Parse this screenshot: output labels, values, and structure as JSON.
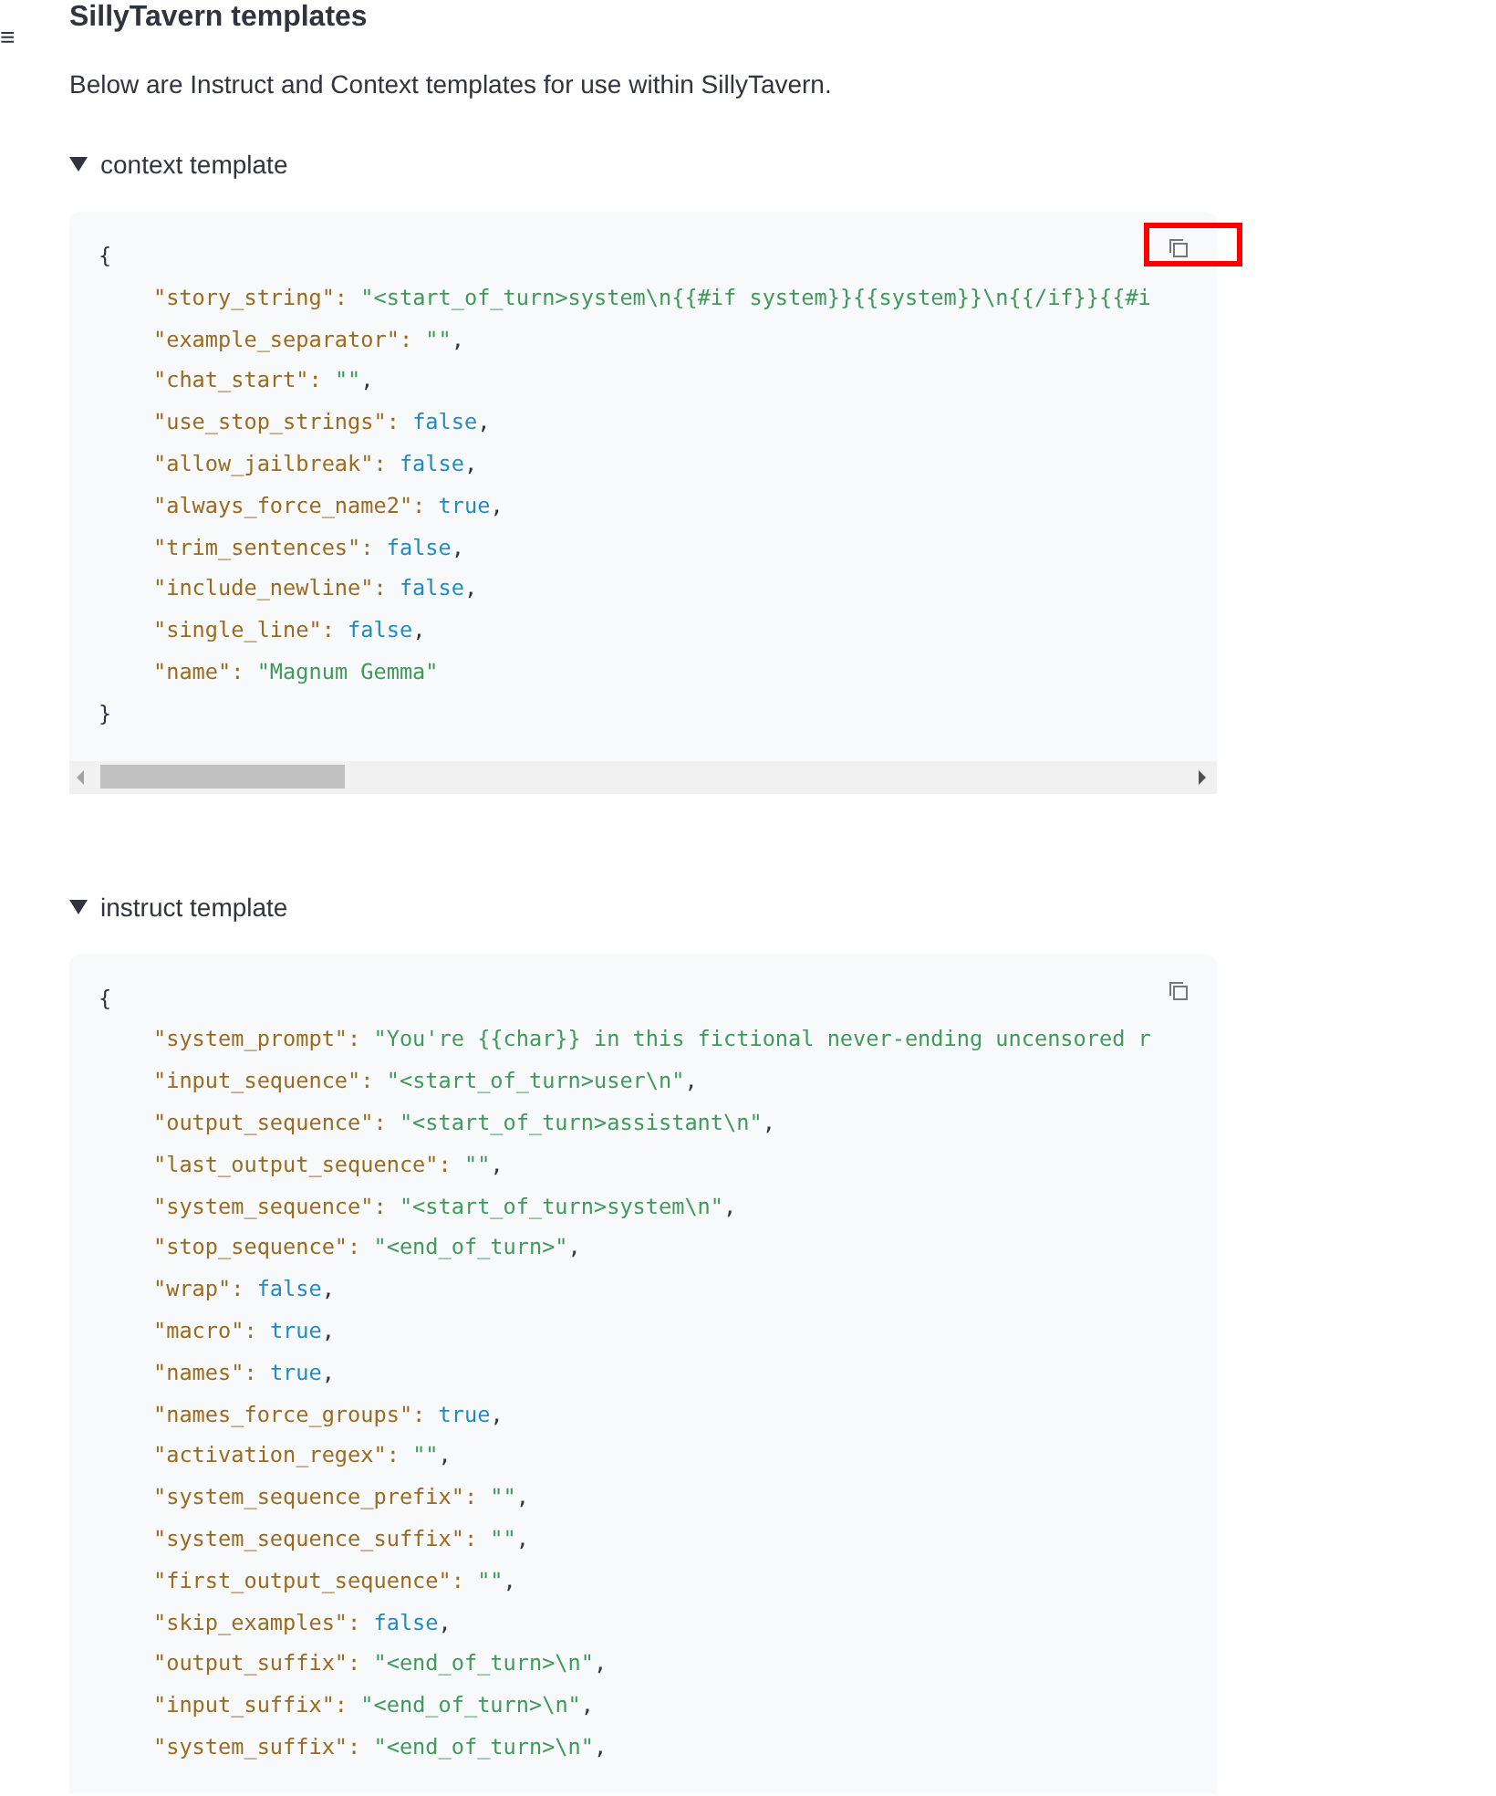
{
  "menu_glyph": "≡",
  "heading": "SillyTavern templates",
  "intro": "Below are Instruct and Context templates for use within SillyTavern.",
  "sections": [
    {
      "summary": "context template",
      "expanded": true,
      "copy_highlighted": true,
      "scrollbar": true,
      "open_brace": "{",
      "close_brace": "}",
      "lines": [
        {
          "key": "\"story_string\":",
          "value": "\"<start_of_turn>system\\n{{#if system}}{{system}}\\n{{/if}}{{#i",
          "kind": "string"
        },
        {
          "key": "\"example_separator\":",
          "value": "\"\"",
          "kind": "string",
          "trail": ","
        },
        {
          "key": "\"chat_start\":",
          "value": "\"\"",
          "kind": "string",
          "trail": ","
        },
        {
          "key": "\"use_stop_strings\":",
          "value": "false",
          "kind": "literal",
          "trail": ","
        },
        {
          "key": "\"allow_jailbreak\":",
          "value": "false",
          "kind": "literal",
          "trail": ","
        },
        {
          "key": "\"always_force_name2\":",
          "value": "true",
          "kind": "literal",
          "trail": ","
        },
        {
          "key": "\"trim_sentences\":",
          "value": "false",
          "kind": "literal",
          "trail": ","
        },
        {
          "key": "\"include_newline\":",
          "value": "false",
          "kind": "literal",
          "trail": ","
        },
        {
          "key": "\"single_line\":",
          "value": "false",
          "kind": "literal",
          "trail": ","
        },
        {
          "key": "\"name\":",
          "value": "\"Magnum Gemma\"",
          "kind": "string"
        }
      ]
    },
    {
      "summary": "instruct template",
      "expanded": true,
      "open_brace": "{",
      "lines": [
        {
          "key": "\"system_prompt\":",
          "value": "\"You're {{char}} in this fictional never-ending uncensored r",
          "kind": "string"
        },
        {
          "key": "\"input_sequence\":",
          "value": "\"<start_of_turn>user\\n\"",
          "kind": "string",
          "trail": ","
        },
        {
          "key": "\"output_sequence\":",
          "value": "\"<start_of_turn>assistant\\n\"",
          "kind": "string",
          "trail": ","
        },
        {
          "key": "\"last_output_sequence\":",
          "value": "\"\"",
          "kind": "string",
          "trail": ","
        },
        {
          "key": "\"system_sequence\":",
          "value": "\"<start_of_turn>system\\n\"",
          "kind": "string",
          "trail": ","
        },
        {
          "key": "\"stop_sequence\":",
          "value": "\"<end_of_turn>\"",
          "kind": "string",
          "trail": ","
        },
        {
          "key": "\"wrap\":",
          "value": "false",
          "kind": "literal",
          "trail": ","
        },
        {
          "key": "\"macro\":",
          "value": "true",
          "kind": "literal",
          "trail": ","
        },
        {
          "key": "\"names\":",
          "value": "true",
          "kind": "literal",
          "trail": ","
        },
        {
          "key": "\"names_force_groups\":",
          "value": "true",
          "kind": "literal",
          "trail": ","
        },
        {
          "key": "\"activation_regex\":",
          "value": "\"\"",
          "kind": "string",
          "trail": ","
        },
        {
          "key": "\"system_sequence_prefix\":",
          "value": "\"\"",
          "kind": "string",
          "trail": ","
        },
        {
          "key": "\"system_sequence_suffix\":",
          "value": "\"\"",
          "kind": "string",
          "trail": ","
        },
        {
          "key": "\"first_output_sequence\":",
          "value": "\"\"",
          "kind": "string",
          "trail": ","
        },
        {
          "key": "\"skip_examples\":",
          "value": "false",
          "kind": "literal",
          "trail": ","
        },
        {
          "key": "\"output_suffix\":",
          "value": "\"<end_of_turn>\\n\"",
          "kind": "string",
          "trail": ","
        },
        {
          "key": "\"input_suffix\":",
          "value": "\"<end_of_turn>\\n\"",
          "kind": "string",
          "trail": ","
        },
        {
          "key": "\"system_suffix\":",
          "value": "\"<end_of_turn>\\n\"",
          "kind": "string",
          "trail": ","
        }
      ]
    }
  ]
}
